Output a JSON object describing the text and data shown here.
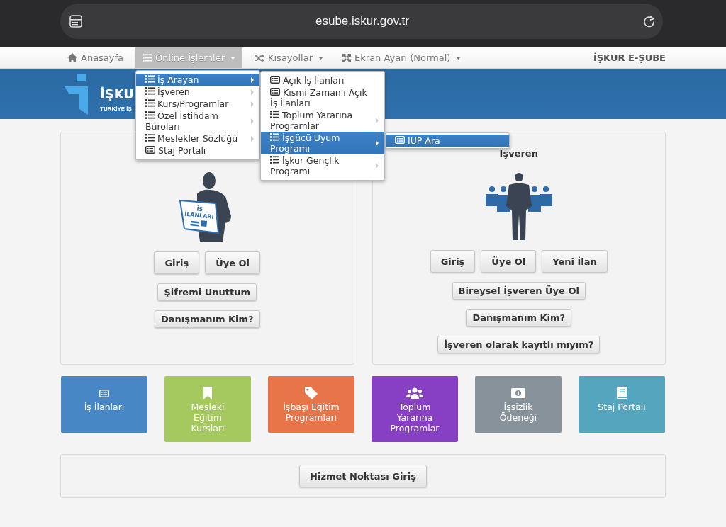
{
  "browser": {
    "url": "esube.iskur.gov.tr"
  },
  "nav": {
    "items": [
      {
        "label": "Anasayfa",
        "kind": "home",
        "caret": false,
        "selected": false
      },
      {
        "label": "Online İşlemler",
        "kind": "list",
        "caret": true,
        "selected": true
      },
      {
        "label": "Kısayollar",
        "kind": "shuffle",
        "caret": true,
        "selected": false
      },
      {
        "label": "Ekran Ayarı (Normal)",
        "kind": "expand",
        "caret": true,
        "selected": false
      }
    ],
    "brand": "İŞKUR E-ŞUBE"
  },
  "banner": {
    "logo_text": "İŞKU",
    "logo_subtitle": "TÜRKİYE İŞ"
  },
  "menus": [
    [
      {
        "lines": [
          "İş Arayan"
        ],
        "kind": "list",
        "submenu": true,
        "selected": true
      },
      {
        "lines": [
          "İşveren"
        ],
        "kind": "list",
        "submenu": true,
        "selected": false
      },
      {
        "lines": [
          "Kurs/Programlar"
        ],
        "kind": "list",
        "submenu": true,
        "selected": false
      },
      {
        "lines": [
          "Özel İstihdam",
          "Büroları"
        ],
        "kind": "list",
        "submenu": true,
        "selected": false
      },
      {
        "lines": [
          "Meslekler Sözlüğü"
        ],
        "kind": "list",
        "submenu": true,
        "selected": false
      },
      {
        "lines": [
          "Staj Portalı"
        ],
        "kind": "card",
        "submenu": false,
        "selected": false
      }
    ],
    [
      {
        "lines": [
          "Açık İş İlanları"
        ],
        "kind": "card",
        "submenu": false,
        "selected": false
      },
      {
        "lines": [
          "Kısmi Zamanlı Açık",
          "İş İlanları"
        ],
        "kind": "card",
        "submenu": false,
        "selected": false
      },
      {
        "lines": [
          "Toplum Yararına",
          "Programlar"
        ],
        "kind": "list",
        "submenu": true,
        "selected": false
      },
      {
        "lines": [
          "İşgücü Uyum",
          "Programı"
        ],
        "kind": "list",
        "submenu": true,
        "selected": true
      },
      {
        "lines": [
          "İşkur Gençlik",
          "Programı"
        ],
        "kind": "list",
        "submenu": true,
        "selected": false
      }
    ],
    [
      {
        "lines": [
          "IUP Ara"
        ],
        "kind": "card",
        "submenu": false,
        "selected": true
      }
    ]
  ],
  "panels": [
    {
      "kind": "reader",
      "figure_text": [
        "İŞ",
        "İLANLARI"
      ],
      "button_rows": [
        [
          "Giriş",
          "Üye Ol"
        ],
        [
          "Şifremi Unuttum"
        ],
        [
          "Danışmanım Kim?"
        ]
      ]
    },
    {
      "title": "İşveren",
      "kind": "group",
      "button_rows": [
        [
          "Giriş",
          "Üye Ol",
          "Yeni İlan"
        ],
        [
          "Bireysel İşveren Üye Ol"
        ],
        [
          "Danışmanım Kim?"
        ],
        [
          "İşveren olarak kayıtlı mıyım?"
        ]
      ]
    }
  ],
  "tiles": [
    {
      "lines": [
        "İş İlanları"
      ],
      "kind": "card",
      "color": "#4787c6"
    },
    {
      "lines": [
        "Mesleki",
        "Eğitim",
        "Kursları"
      ],
      "kind": "bookmark",
      "color": "#a5c95e"
    },
    {
      "lines": [
        "İşbaşı Eğitim",
        "Programları"
      ],
      "kind": "tag",
      "color": "#e8744a"
    },
    {
      "lines": [
        "Toplum",
        "Yararına",
        "Programlar"
      ],
      "kind": "group",
      "color": "#8740c4"
    },
    {
      "lines": [
        "İşsizlik",
        "Ödeneği"
      ],
      "kind": "money",
      "color": "#88929a"
    },
    {
      "lines": [
        "Staj Portalı"
      ],
      "kind": "book",
      "color": "#55a5bf"
    }
  ],
  "service": {
    "button": "Hizmet Noktası Giriş"
  }
}
